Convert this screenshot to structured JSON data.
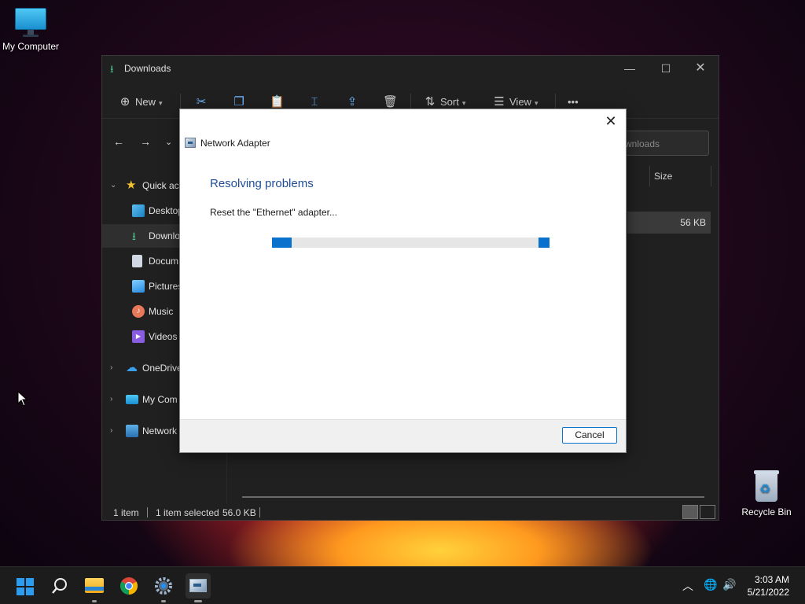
{
  "desktop": {
    "icons": [
      {
        "label": "My Computer",
        "icon": "monitor-icon"
      },
      {
        "label": "Recycle Bin",
        "icon": "recycle-bin-icon"
      }
    ]
  },
  "explorer": {
    "title": "Downloads",
    "toolbar": {
      "new_label": "New",
      "sort_label": "Sort",
      "view_label": "View",
      "more_label": "•••",
      "icons": [
        "cut-icon",
        "copy-icon",
        "paste-icon",
        "rename-icon",
        "share-icon",
        "delete-icon"
      ]
    },
    "search_placeholder": "Search Downloads",
    "search_visible_text": "wnloads",
    "sidebar": [
      {
        "label": "Quick access",
        "visible": "Quick ac",
        "icon": "star-icon",
        "chevron": "⌄"
      },
      {
        "label": "Desktop",
        "visible": "Desktop",
        "icon": "desktop-folder-icon"
      },
      {
        "label": "Downloads",
        "visible": "Downlo",
        "icon": "download-icon",
        "selected": true
      },
      {
        "label": "Documents",
        "visible": "Docum",
        "icon": "documents-icon"
      },
      {
        "label": "Pictures",
        "visible": "Pictures",
        "icon": "pictures-icon"
      },
      {
        "label": "Music",
        "visible": "Music",
        "icon": "music-icon"
      },
      {
        "label": "Videos",
        "visible": "Videos",
        "icon": "videos-icon"
      },
      {
        "label": "OneDrive",
        "visible": "OneDrive",
        "icon": "cloud-icon",
        "chevron": "›"
      },
      {
        "label": "My Computer",
        "visible": "My Com",
        "icon": "monitor-icon",
        "chevron": "›"
      },
      {
        "label": "Network",
        "visible": "Network",
        "icon": "network-icon",
        "chevron": "›"
      }
    ],
    "column_size": "Size",
    "file_size": "56 KB",
    "status": {
      "items": "1 item",
      "selected": "1 item selected",
      "size": "56.0 KB"
    }
  },
  "dialog": {
    "app_name": "Network Adapter",
    "heading": "Resolving problems",
    "message": "Reset the \"Ethernet\" adapter...",
    "cancel_label": "Cancel",
    "progress_state": "indeterminate"
  },
  "taskbar": {
    "apps": [
      "start-icon",
      "search-icon",
      "file-explorer-icon",
      "chrome-icon",
      "settings-icon",
      "troubleshooter-icon"
    ],
    "time": "3:03 AM",
    "date": "5/21/2022"
  },
  "colors": {
    "accent": "#0a72cc",
    "heading_blue": "#1f4e99",
    "explorer_bg": "#202020",
    "taskbar_bg": "#1c1c1c"
  }
}
